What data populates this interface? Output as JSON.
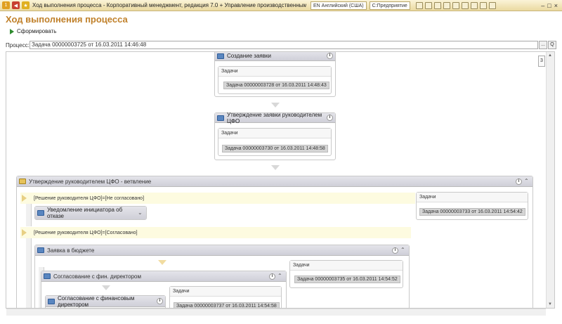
{
  "window": {
    "title": "Ход выполнения процесса - Корпоративный менеджмент, редакция 7.0 + Управление производственным предприятием,",
    "language": "EN Английский (США)",
    "app": "С:Предприятие"
  },
  "page": {
    "heading": "Ход выполнения процесса",
    "generate_label": "Сформировать",
    "process_label": "Процесс:",
    "process_value": "Задача 00000003725 от 16.03.2011 14:46:48",
    "select_btn": "...",
    "open_btn": "Q"
  },
  "diagram": {
    "node1": {
      "title": "Создание заявки",
      "tasks_label": "Задачи",
      "task": "Задача 00000003728 от 16.03.2011 14:48:43"
    },
    "node2": {
      "title": "Утверждение заявки руководителем ЦФО",
      "tasks_label": "Задачи",
      "task": "Задача 00000003730 от 16.03.2011 14:48:58"
    },
    "branch": {
      "title": "Утверждение руководителем ЦФО - ветвление",
      "cond1": "[Решение руководителя ЦФО]=[Не согласовано]",
      "notify_title": "Уведомление инициатора об отказе",
      "tasks1_label": "Задачи",
      "task1": "Задача 00000003733 от 16.03.2011 14:54:42",
      "cond2": "[Решение руководителя ЦФО]=[Согласовано]",
      "budget_title": "Заявка в бюджете",
      "fin_title": "Согласование с фин. директором",
      "tasks2_label": "Задачи",
      "task2": "Задача 00000003735 от 16.03.2011 14:54:52",
      "findir_title": "Согласование с финансовым директором",
      "tasks3_label": "Задачи",
      "task3": "Задача 00000003737 от 16.03.2011 14:54:58"
    }
  },
  "icons": {
    "info": "i",
    "collapse_up": "⌃",
    "collapse_down": "⌄"
  }
}
